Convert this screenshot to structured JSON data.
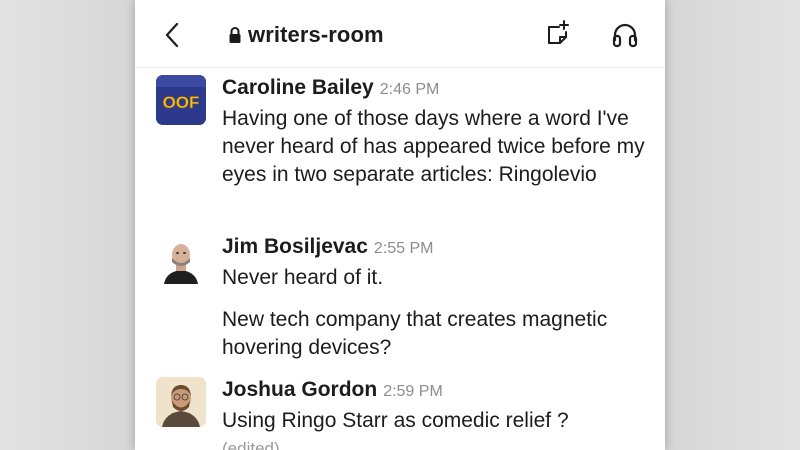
{
  "header": {
    "back_icon": "chevron-left-icon",
    "channel_icon": "lock-icon",
    "channel_name": "writers-room",
    "actions": [
      {
        "icon": "note-add-icon"
      },
      {
        "icon": "headphones-icon"
      }
    ]
  },
  "messages": [
    {
      "author": "Caroline Bailey",
      "time": "2:46 PM",
      "avatar": {
        "text": "OOF",
        "bg": "#2d3a8c",
        "fg": "#f2c230"
      },
      "paragraphs": [
        "Having one of those days where a word I've never heard of has appeared twice before my eyes in two separate articles: Ringolevio"
      ]
    },
    {
      "author": "Jim Bosiljevac",
      "time": "2:55 PM",
      "paragraphs": [
        "Never heard of it.",
        "New tech company that creates magnetic hovering devices?"
      ]
    },
    {
      "author": "Joshua Gordon",
      "time": "2:59 PM",
      "paragraphs": [
        "Using Ringo Starr as comedic relief ?"
      ],
      "edited_label": "(edited)"
    }
  ]
}
